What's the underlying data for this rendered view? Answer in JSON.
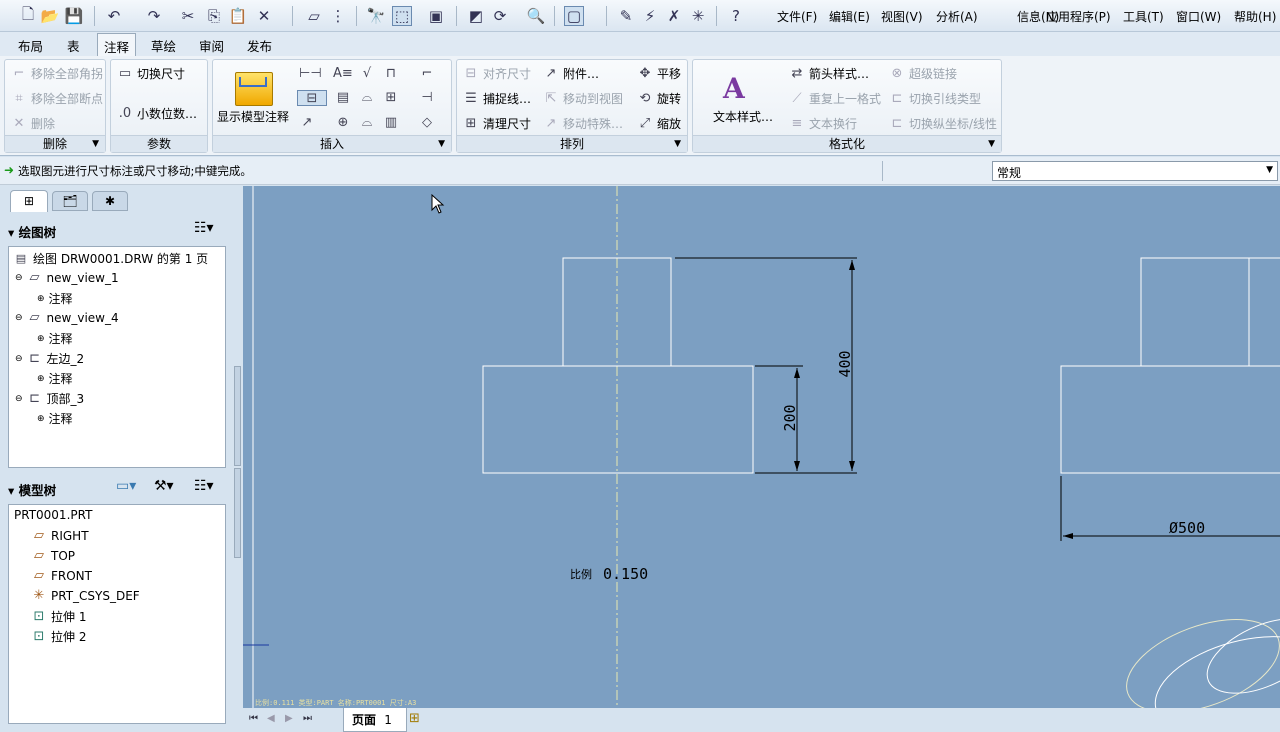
{
  "quick_access": {
    "menus": [
      "文件(F)",
      "编辑(E)",
      "视图(V)",
      "分析(A)",
      "信息(N)",
      "应用程序(P)",
      "工具(T)",
      "窗口(W)",
      "帮助(H)"
    ]
  },
  "ribbon_tabs": [
    "布局",
    "表",
    "注释",
    "草绘",
    "审阅",
    "发布"
  ],
  "active_tab": "注释",
  "ribbon": {
    "delete_group": {
      "title": "删除",
      "items": [
        "移除全部角拐",
        "移除全部断点",
        "删除"
      ]
    },
    "params_group": {
      "title": "参数",
      "items": [
        "切换尺寸",
        "小数位数…"
      ]
    },
    "insert_group": {
      "title": "插入",
      "big_button": "显示模型注释"
    },
    "arrange_group": {
      "title": "排列",
      "items": [
        "对齐尺寸",
        "附件…",
        "平移",
        "捕捉线…",
        "移动到视图",
        "旋转",
        "清理尺寸",
        "移动特殊…",
        "缩放"
      ]
    },
    "format_group": {
      "title": "格式化",
      "big_button": "文本样式…",
      "items": [
        "箭头样式…",
        "超级链接",
        "重复上一格式",
        "切换引线类型",
        "文本换行",
        "切换纵坐标/线性"
      ]
    }
  },
  "status": {
    "message": "选取图元进行尺寸标注或尺寸移动;中键完成。",
    "filter_value": "常规"
  },
  "drawing_tree": {
    "title": "绘图树",
    "root": "绘图 DRW0001.DRW 的第 1 页",
    "items": [
      {
        "label": "new_view_1",
        "child": "注释"
      },
      {
        "label": "new_view_4",
        "child": "注释"
      },
      {
        "label": "左边_2",
        "child": "注释"
      },
      {
        "label": "顶部_3",
        "child": "注释"
      }
    ]
  },
  "model_tree": {
    "title": "模型树",
    "root": "PRT0001.PRT",
    "items": [
      "RIGHT",
      "TOP",
      "FRONT",
      "PRT_CSYS_DEF",
      "拉伸 1",
      "拉伸 2"
    ]
  },
  "drawing": {
    "dim_400": "400",
    "dim_200": "200",
    "dim_diam": "Ø500",
    "scale_label": "比例",
    "scale_value": "0.150",
    "footer_text": "比例:0.111  类型:PART  名称:PRT0001  尺寸:A3"
  },
  "pager": {
    "page_label": "页面",
    "page_number": "1"
  }
}
